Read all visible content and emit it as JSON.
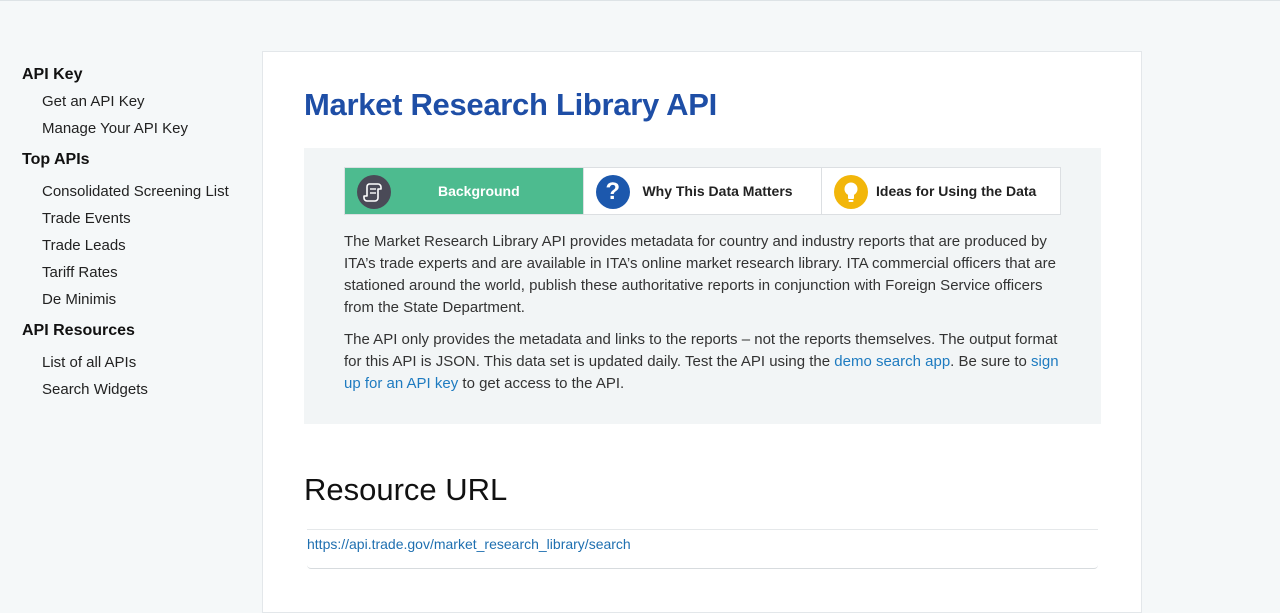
{
  "sidebar": {
    "sections": [
      {
        "heading": "API Key",
        "items": [
          "Get an API Key",
          "Manage Your API Key"
        ]
      },
      {
        "heading": "Top APIs",
        "items": [
          "Consolidated Screening List",
          "Trade Events",
          "Trade Leads",
          "Tariff Rates",
          "De Minimis"
        ]
      },
      {
        "heading": "API Resources",
        "items": [
          "List of all APIs",
          "Search Widgets"
        ]
      }
    ]
  },
  "main": {
    "title": "Market Research Library API",
    "tabs": [
      {
        "label": "Background",
        "icon": "scroll-icon",
        "active": true
      },
      {
        "label": "Why This Data Matters",
        "icon": "question-icon",
        "active": false
      },
      {
        "label": "Ideas for Using the Data",
        "icon": "lightbulb-icon",
        "active": false
      }
    ],
    "description": {
      "p1": "The Market Research Library API provides metadata for country and industry reports that are produced by ITA’s trade experts and are available in ITA’s online market research library. ITA commercial officers that are stationed around the world, publish these authoritative reports in conjunction with Foreign Service officers from the State Department.",
      "p2_before": "The API only provides the metadata and links to the reports – not the reports themselves. The output format for this API is JSON. This data set is updated daily. Test the API using the ",
      "p2_link1": "demo search app",
      "p2_middle": ". Be sure to ",
      "p2_link2": "sign up for an API key",
      "p2_after": " to get access to the API."
    },
    "resource": {
      "heading": "Resource URL",
      "url": "https://api.trade.gov/market_research_library/search"
    }
  },
  "colors": {
    "accent": "#1e4ea6",
    "active_tab": "#4dbb8f",
    "link": "#1e7bc0",
    "question_icon_bg": "#1c58ad",
    "bulb_icon_bg": "#f2b60a"
  }
}
